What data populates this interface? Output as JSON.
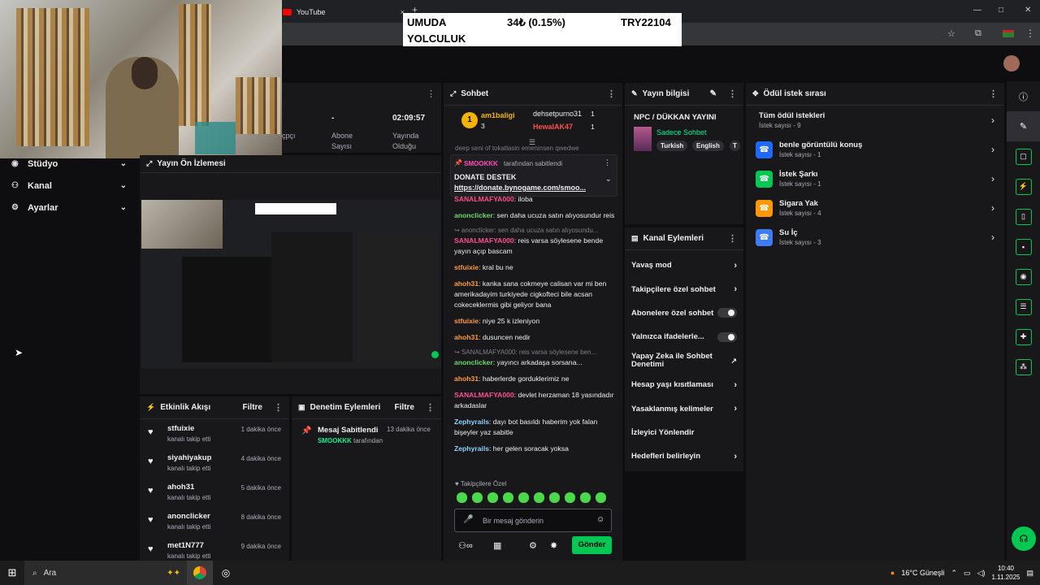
{
  "browser": {
    "tab_title": "YouTube",
    "new_tab": "+",
    "tab_close": "×",
    "minimize": "—",
    "maximize": "□",
    "close": "✕"
  },
  "ticker": {
    "line1": "UMUDA",
    "line2": "YOLCULUK",
    "change": "34₺ (0.15%)",
    "code": "TRY22104"
  },
  "left_nav": [
    {
      "label": "Stüdyo",
      "icon": "studio-icon"
    },
    {
      "label": "Kanal",
      "icon": "channel-icon"
    },
    {
      "label": "Ayarlar",
      "icon": "gear-icon"
    }
  ],
  "stats": {
    "partial_label": "çpçı",
    "subs_value": "-",
    "subs_label_1": "Abone",
    "subs_label_2": "Sayısı",
    "uptime_value": "02:09:57",
    "uptime_label_1": "Yayında",
    "uptime_label_2": "Olduğu"
  },
  "preview": {
    "title": "Yayın Ön İzlemesi"
  },
  "chat": {
    "title": "Sohbet",
    "leaders": [
      {
        "rank": "1",
        "name": "am1baligi",
        "count": "3"
      },
      {
        "name": "dehsetpurno31",
        "count": "1"
      },
      {
        "name": "HewalAK47",
        "count": "1"
      }
    ],
    "pinned": {
      "pinned_by_user": "SMOOKKK",
      "pinned_by_text": "tarafından sabitlendi",
      "title": "DONATE DESTEK",
      "link": "https://donate.bynogame.com/smoo..."
    },
    "partial_top": "deep seni of tokatlasin emeninsen qwedwe",
    "messages": [
      {
        "user": "SANALMAFYA000",
        "text": "iloba",
        "color": "#ff4f91"
      },
      {
        "user": "anonclicker",
        "text": "sen daha ucuza satın alıyosundur reis",
        "color": "#6bd96b"
      },
      {
        "reply": "↪ anonclicker: sen daha ucuza satın alıyosundu..."
      },
      {
        "user": "SANALMAFYA000",
        "text": "reis varsa söylesene bende yayın açıp bascam",
        "color": "#ff4f91"
      },
      {
        "user": "stfuixie",
        "text": "kral bu ne",
        "color": "#ff9a3d"
      },
      {
        "user": "ahoh31",
        "text": "kanka sana cokmeye calisan var mi ben amerikadayim turkiyede cigkofteci bile acsan cokeceklermis gibi geliyor bana",
        "color": "#ff9a3d"
      },
      {
        "user": "stfuixie",
        "text": "niye 25 k izleniyon",
        "color": "#ff9a3d"
      },
      {
        "user": "ahoh31",
        "text": "dusuncen nedir",
        "color": "#ff9a3d"
      },
      {
        "reply": "↪ SANALMAFYA000: reis varsa söylesene ben..."
      },
      {
        "user": "anonclicker",
        "text": "yayıncı arkadaşa sorsana...",
        "color": "#6bd96b"
      },
      {
        "user": "ahoh31",
        "text": "haberlerde gorduklerimiz ne",
        "color": "#ff9a3d"
      },
      {
        "user": "SANALMAFYA000",
        "text": "devlet herzaman 18 yasındadır arkadaslar",
        "color": "#ff4f91"
      },
      {
        "user": "Zephyrails",
        "text": "dayı bot basıldı haberim yok falan bişeyler yaz sabitle",
        "color": "#8fd0ff"
      },
      {
        "user": "Zephyrails",
        "text": "her gelen soracak yoksa",
        "color": "#8fd0ff"
      }
    ],
    "followers_only": "♥ Takipçilere Özel",
    "input_placeholder": "Bir mesaj gönderin",
    "send": "Gönder"
  },
  "stream_info": {
    "title": "Yayın bilgisi",
    "stream_name": "NPC / DÜKKAN YAYINI",
    "category": "Sadece Sohbet",
    "tags": [
      "Turkish",
      "English",
      "T"
    ]
  },
  "channel_actions": {
    "title": "Kanal Eylemleri",
    "items": [
      {
        "label": "Yavaş mod",
        "kind": "arrow"
      },
      {
        "label": "Takipçilere özel sohbet",
        "kind": "arrow"
      },
      {
        "label": "Abonelere özel sohbet",
        "kind": "toggle"
      },
      {
        "label": "Yalnızca ifadelerle...",
        "kind": "toggle"
      },
      {
        "label": "Yapay Zeka ile Sohbet Denetimi",
        "kind": "external"
      },
      {
        "label": "Hesap yaşı kısıtlaması",
        "kind": "arrow"
      },
      {
        "label": "Yasaklanmış kelimeler",
        "kind": "arrow"
      },
      {
        "label": "İzleyici Yönlendir",
        "kind": "none"
      },
      {
        "label": "Hedefleri belirleyin",
        "kind": "arrow"
      }
    ]
  },
  "rewards": {
    "title": "Ödül istek sırası",
    "all_title": "Tüm ödül istekleri",
    "all_count": "İstek sayısı - 9",
    "items": [
      {
        "title": "benle görüntülü konuş",
        "count": "İstek sayısı - 1",
        "color": "#1f69ff"
      },
      {
        "title": "İstek Şarkı",
        "count": "İstek sayısı - 1",
        "color": "#00c853"
      },
      {
        "title": "Sigara Yak",
        "count": "İstek sayısı - 4",
        "color": "#ff9800"
      },
      {
        "title": "Su İç",
        "count": "İstek sayısı - 3",
        "color": "#3d7cf5"
      }
    ]
  },
  "activity": {
    "title": "Etkinlik Akışı",
    "filter": "Filtre",
    "items": [
      {
        "name": "stfuixie",
        "sub": "kanalı takip etti",
        "time": "1 dakika önce"
      },
      {
        "name": "siyahiyakup",
        "sub": "kanalı takip etti",
        "time": "4 dakika önce"
      },
      {
        "name": "ahoh31",
        "sub": "kanalı takip etti",
        "time": "5 dakika önce"
      },
      {
        "name": "anonclicker",
        "sub": "kanalı takip etti",
        "time": "8 dakika önce"
      },
      {
        "name": "met1N777",
        "sub": "kanalı takip etti",
        "time": "9 dakika önce"
      }
    ]
  },
  "moderation": {
    "title": "Denetim Eylemleri",
    "filter": "Filtre",
    "item_title": "Mesaj Sabitlendi",
    "item_time": "13 dakika önce",
    "item_user": "SMOOKKK",
    "item_suffix": "tarafından"
  },
  "taskbar": {
    "search": "Ara",
    "weather": "16°C Güneşli",
    "time": "10:40",
    "date": "1.11.2025"
  }
}
